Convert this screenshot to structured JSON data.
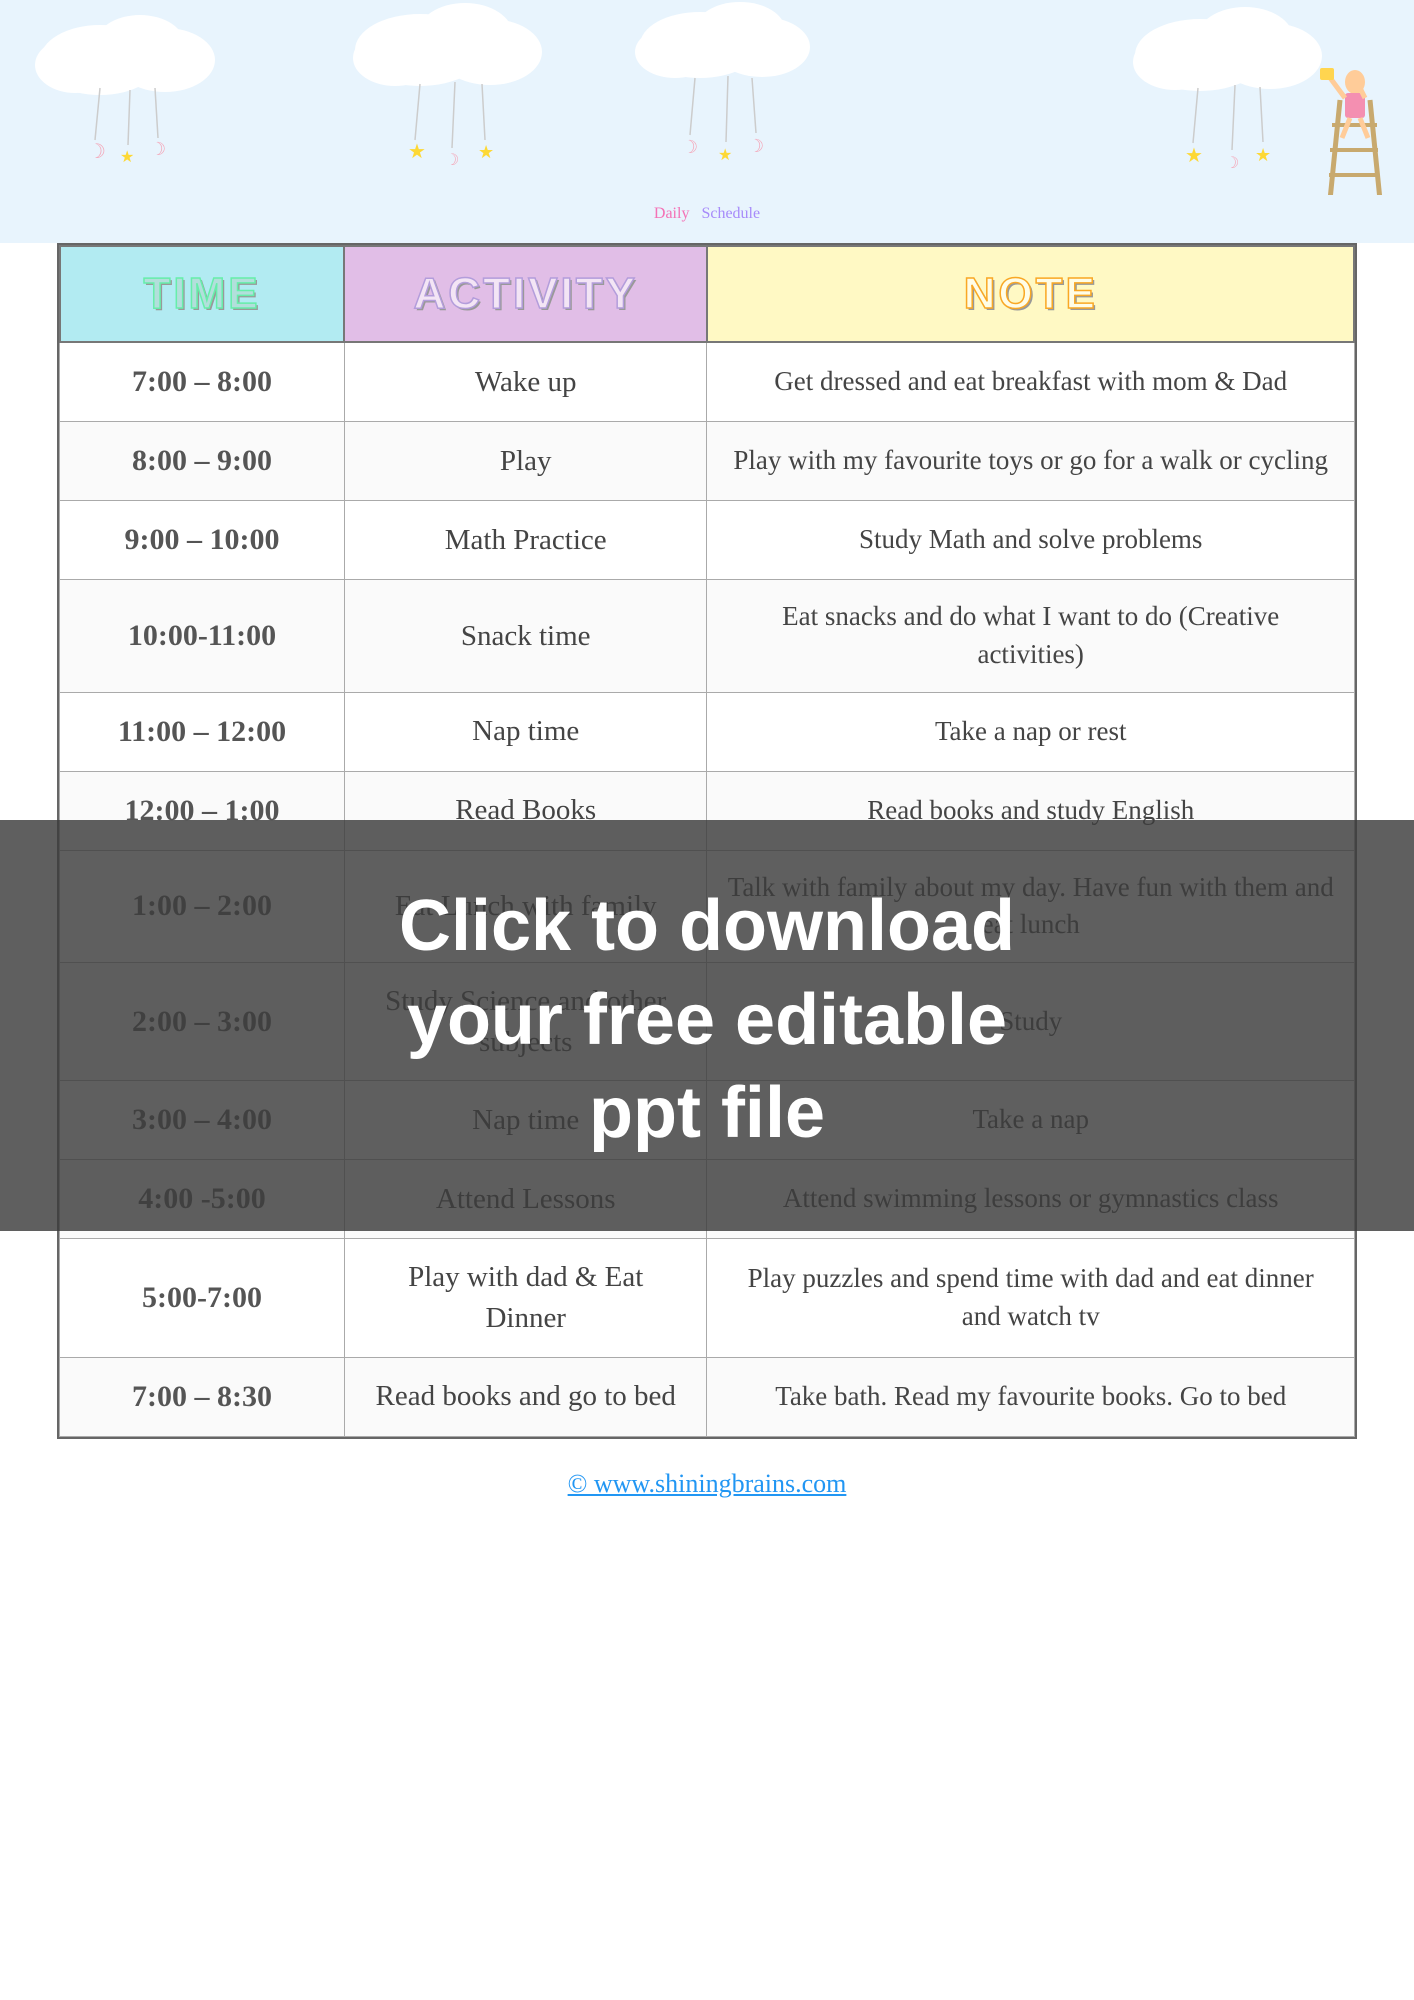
{
  "header": {
    "title_daily": "Daily",
    "title_schedule": "Schedule",
    "sky_bg": "#e8f4fd"
  },
  "table": {
    "headers": {
      "time": "TIME",
      "activity": "ACTIVITY",
      "note": "NOTE"
    },
    "rows": [
      {
        "time": "7:00 – 8:00",
        "activity": "Wake up",
        "note": "Get dressed and eat breakfast with mom & Dad"
      },
      {
        "time": "8:00 – 9:00",
        "activity": "Play",
        "note": "Play with my favourite toys or go for a walk or cycling"
      },
      {
        "time": "9:00 – 10:00",
        "activity": "Math Practice",
        "note": "Study Math and solve problems"
      },
      {
        "time": "10:00-11:00",
        "activity": "Snack time",
        "note": "Eat snacks and do what I want to do (Creative activities)"
      },
      {
        "time": "11:00 – 12:00",
        "activity": "Nap time",
        "note": "Take a nap or rest"
      },
      {
        "time": "12:00 – 1:00",
        "activity": "Read Books",
        "note": "Read books and study English"
      },
      {
        "time": "1:00 – 2:00",
        "activity": "Eat Lunch with family",
        "note": "Talk with family about my day. Have fun with them and eat lunch"
      },
      {
        "time": "2:00 – 3:00",
        "activity": "Study Science and other subjects",
        "note": "Study"
      },
      {
        "time": "3:00 – 4:00",
        "activity": "Nap time",
        "note": "Take a nap"
      },
      {
        "time": "4:00 -5:00",
        "activity": "Attend Lessons",
        "note": "Attend swimming lessons or gymnastics class"
      },
      {
        "time": "5:00-7:00",
        "activity": "Play with dad & Eat Dinner",
        "note": "Play puzzles and spend time with dad and eat dinner and watch tv"
      },
      {
        "time": "7:00 – 8:30",
        "activity": "Read books and go to bed",
        "note": "Take bath. Read my favourite books. Go to bed"
      }
    ]
  },
  "watermark": {
    "line1": "Click to download",
    "line2": "your free editable",
    "line3": "ppt file"
  },
  "footer": {
    "website": "© www.shiningbrains.com"
  }
}
